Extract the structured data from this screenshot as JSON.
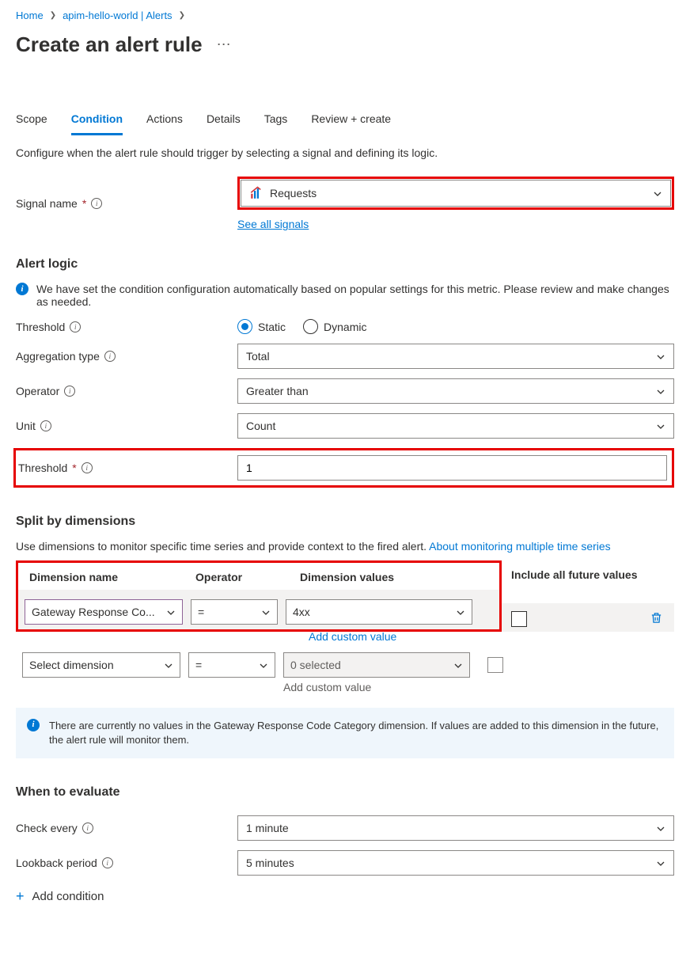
{
  "breadcrumb": {
    "home": "Home",
    "item": "apim-hello-world | Alerts"
  },
  "title": "Create an alert rule",
  "tabs": {
    "scope": "Scope",
    "condition": "Condition",
    "actions": "Actions",
    "details": "Details",
    "tags": "Tags",
    "review": "Review + create"
  },
  "condition_desc": "Configure when the alert rule should trigger by selecting a signal and defining its logic.",
  "signal": {
    "label": "Signal name",
    "value": "Requests",
    "see_all": "See all signals"
  },
  "alert_logic": {
    "heading": "Alert logic",
    "info_text": "We have set the condition configuration automatically based on popular settings for this metric. Please review and make changes as needed.",
    "threshold_label": "Threshold",
    "static": "Static",
    "dynamic": "Dynamic",
    "agg_label": "Aggregation type",
    "agg_value": "Total",
    "operator_label": "Operator",
    "operator_value": "Greater than",
    "unit_label": "Unit",
    "unit_value": "Count",
    "thresh_val_label": "Threshold",
    "thresh_val": "1"
  },
  "dimensions": {
    "heading": "Split by dimensions",
    "desc_pre": "Use dimensions to monitor specific time series and provide context to the fired alert. ",
    "desc_link": "About monitoring multiple time series",
    "cols": {
      "name": "Dimension name",
      "op": "Operator",
      "val": "Dimension values",
      "inc": "Include all future values"
    },
    "row1": {
      "name": "Gateway Response Co...",
      "op": "=",
      "val": "4xx",
      "add": "Add custom value"
    },
    "row2": {
      "name": "Select dimension",
      "op": "=",
      "val": "0 selected",
      "add": "Add custom value"
    },
    "note": "There are currently no values in the Gateway Response Code Category dimension. If values are added to this dimension in the future, the alert rule will monitor them."
  },
  "evaluate": {
    "heading": "When to evaluate",
    "check_label": "Check every",
    "check_value": "1 minute",
    "lookback_label": "Lookback period",
    "lookback_value": "5 minutes"
  },
  "add_condition": "Add condition"
}
